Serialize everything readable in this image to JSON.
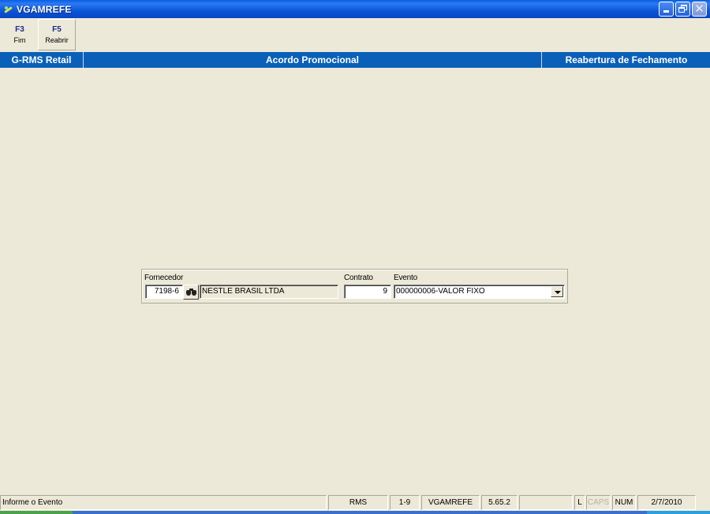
{
  "window": {
    "title": "VGAMREFE",
    "controls": [
      "minimize-icon",
      "restore-icon",
      "close-icon"
    ]
  },
  "toolbar": {
    "buttons": [
      {
        "key": "F3",
        "label": "Fim"
      },
      {
        "key": "F5",
        "label": "Reabrir"
      }
    ]
  },
  "header": {
    "left": "G-RMS Retail",
    "center": "Acordo Promocional",
    "right": "Reabertura de Fechamento"
  },
  "form": {
    "fornecedor": {
      "label": "Fornecedor",
      "code": "7198-6",
      "name": "NESTLE BRASIL LTDA",
      "lookup_icon": "binoculars-icon"
    },
    "contrato": {
      "label": "Contrato",
      "value": "9"
    },
    "evento": {
      "label": "Evento",
      "value": "000000006-VALOR FIXO"
    }
  },
  "statusbar": {
    "message": "Informe o Evento",
    "system": "RMS",
    "range": "1-9",
    "program": "VGAMREFE",
    "version": "5.65.2",
    "empty": "",
    "l": "L",
    "caps": "CAPS",
    "num": "NUM",
    "date": "2/7/2010"
  },
  "colors": {
    "titlebar": "#0a55d8",
    "header_band": "#0a60b8",
    "background": "#ece9d8"
  }
}
